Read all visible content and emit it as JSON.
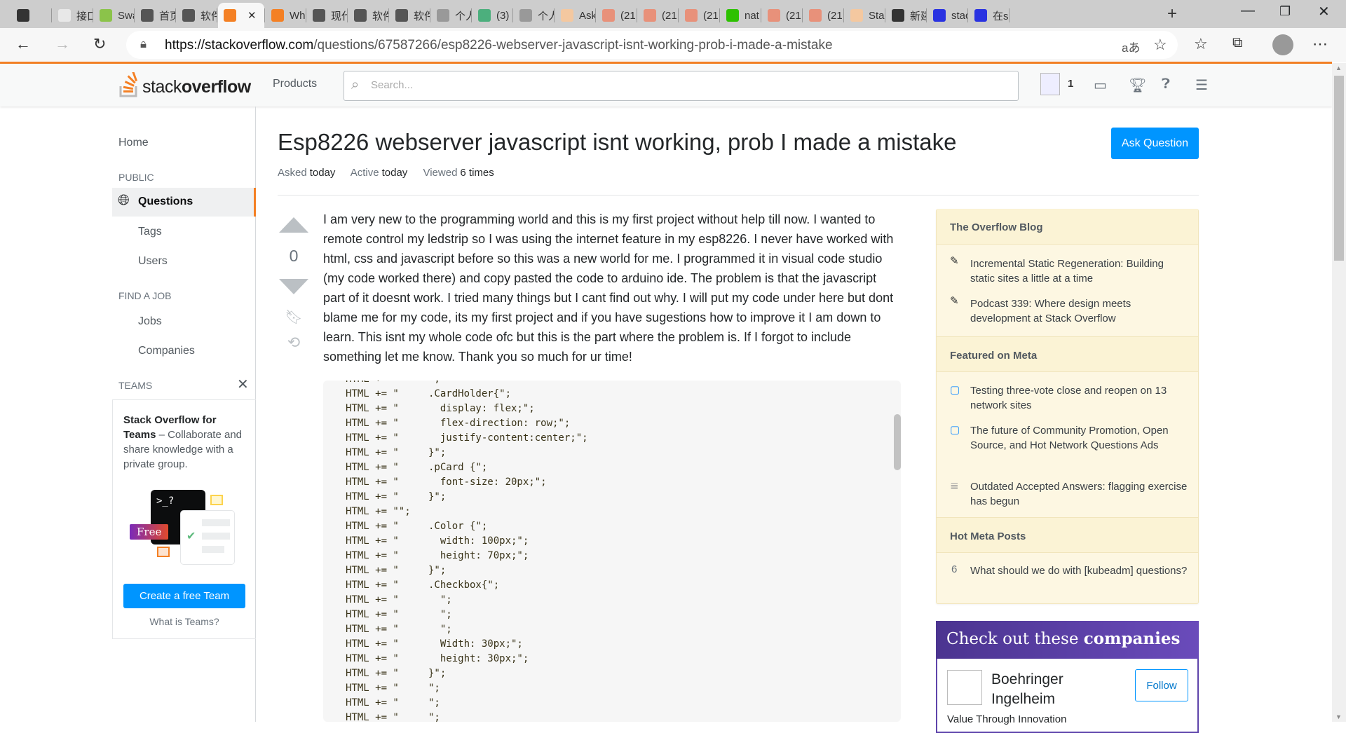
{
  "browser": {
    "tabs": [
      {
        "label": "",
        "color": "#333"
      },
      {
        "label": "接口",
        "color": "#e8e8e8"
      },
      {
        "label": "Swa",
        "color": "#8bc34a"
      },
      {
        "label": "首页",
        "color": "#555"
      },
      {
        "label": "软件",
        "color": "#555"
      },
      {
        "label": "",
        "color": "#f48024",
        "active": true
      },
      {
        "label": "Wh",
        "color": "#f48024"
      },
      {
        "label": "现代",
        "color": "#555"
      },
      {
        "label": "软件",
        "color": "#555"
      },
      {
        "label": "软件",
        "color": "#555"
      },
      {
        "label": "个人",
        "color": "#999"
      },
      {
        "label": "(3)",
        "color": "#4caf7d"
      },
      {
        "label": "个人",
        "color": "#999"
      },
      {
        "label": "Ask",
        "color": "#f4c8a0"
      },
      {
        "label": "(21",
        "color": "#e8917a"
      },
      {
        "label": "(21",
        "color": "#e8917a"
      },
      {
        "label": "(21",
        "color": "#e8917a"
      },
      {
        "label": "nat",
        "color": "#2dc100"
      },
      {
        "label": "(21",
        "color": "#e8917a"
      },
      {
        "label": "(21",
        "color": "#e8917a"
      },
      {
        "label": "Sta",
        "color": "#f4c8a0"
      },
      {
        "label": "新建",
        "color": "#333"
      },
      {
        "label": "stac",
        "color": "#2932e1"
      },
      {
        "label": "在s",
        "color": "#2932e1"
      }
    ],
    "tab_close": "✕",
    "new_tab": "+",
    "url_host": "https://stackoverflow.com",
    "url_path": "/questions/67587266/esp8226-webserver-javascript-isnt-working-prob-i-made-a-mistake",
    "read_aloud": "aあ"
  },
  "header": {
    "logo_a": "stack",
    "logo_b": "overflow",
    "products": "Products",
    "search_placeholder": "Search...",
    "rep": "1"
  },
  "sidebar": {
    "home": "Home",
    "public": "PUBLIC",
    "questions": "Questions",
    "tags": "Tags",
    "users": "Users",
    "find_job": "FIND A JOB",
    "jobs": "Jobs",
    "companies": "Companies",
    "teams": "TEAMS",
    "teams_title": "Stack Overflow for Teams",
    "teams_desc": " – Collaborate and share knowledge with a private group.",
    "free_badge": "Free",
    "prompt": ">_?",
    "create_team": "Create a free Team",
    "what_is": "What is Teams?"
  },
  "question": {
    "title": "Esp8226 webserver javascript isnt working, prob I made a mistake",
    "ask_button": "Ask Question",
    "asked_label": "Asked",
    "asked": "today",
    "active_label": "Active",
    "active": "today",
    "viewed_label": "Viewed",
    "viewed": "6 times",
    "votes": "0",
    "body": "I am very new to the programming world and this is my first project without help till now. I wanted to remote control my ledstrip so I was using the internet feature in my esp8226. I never have worked with html, css and javascript before so this was a new world for me. I programmed it in visual code studio (my code worked there) and copy pasted the code to arduino ide. The problem is that the javascript part of it doesnt work. I tried many things but I cant find out why. I will put my code under here but dont blame me for my code, its my first project and if you have sugestions how to improve it I am down to learn. This isnt my whole code ofc but this is the part where the problem is. If I forgot to include something let me know. Thank you so much for ur time!",
    "code": "HTML += \"     \";\nHTML += \"     .CardHolder{\";\nHTML += \"       display: flex;\";\nHTML += \"       flex-direction: row;\";\nHTML += \"       justify-content:center;\";\nHTML += \"     }\";\nHTML += \"     .pCard {\";\nHTML += \"       font-size: 20px;\";\nHTML += \"     }\";\nHTML += \"\";\nHTML += \"     .Color {\";\nHTML += \"       width: 100px;\";\nHTML += \"       height: 70px;\";\nHTML += \"     }\";\nHTML += \"     .Checkbox{\";\nHTML += \"       \";\nHTML += \"       \";\nHTML += \"       \";\nHTML += \"       Width: 30px;\";\nHTML += \"       height: 30px;\";\nHTML += \"     }\";\nHTML += \"     \";\nHTML += \"     \";\nHTML += \"     \";"
  },
  "right": {
    "blog_title": "The Overflow Blog",
    "blog": [
      "Incremental Static Regeneration: Building static sites a little at a time",
      "Podcast 339: Where design meets development at Stack Overflow"
    ],
    "meta_title": "Featured on Meta",
    "meta": [
      "Testing three-vote close and reopen on 13 network sites",
      "The future of Community Promotion, Open Source, and Hot Network Questions Ads",
      "Outdated Accepted Answers: flagging exercise has begun"
    ],
    "hot_title": "Hot Meta Posts",
    "hot": [
      {
        "count": "6",
        "title": "What should we do with [kubeadm] questions?"
      }
    ],
    "companies_a": "Check out these ",
    "companies_b": "companies",
    "company_name": "Boehringer Ingelheim",
    "company_tagline": "Value Through Innovation",
    "follow": "Follow"
  },
  "colors": {
    "accent": "#f48024",
    "button": "#0095ff",
    "sidebar_bg": "#fdf7e2",
    "companies": "#5e44ab"
  }
}
